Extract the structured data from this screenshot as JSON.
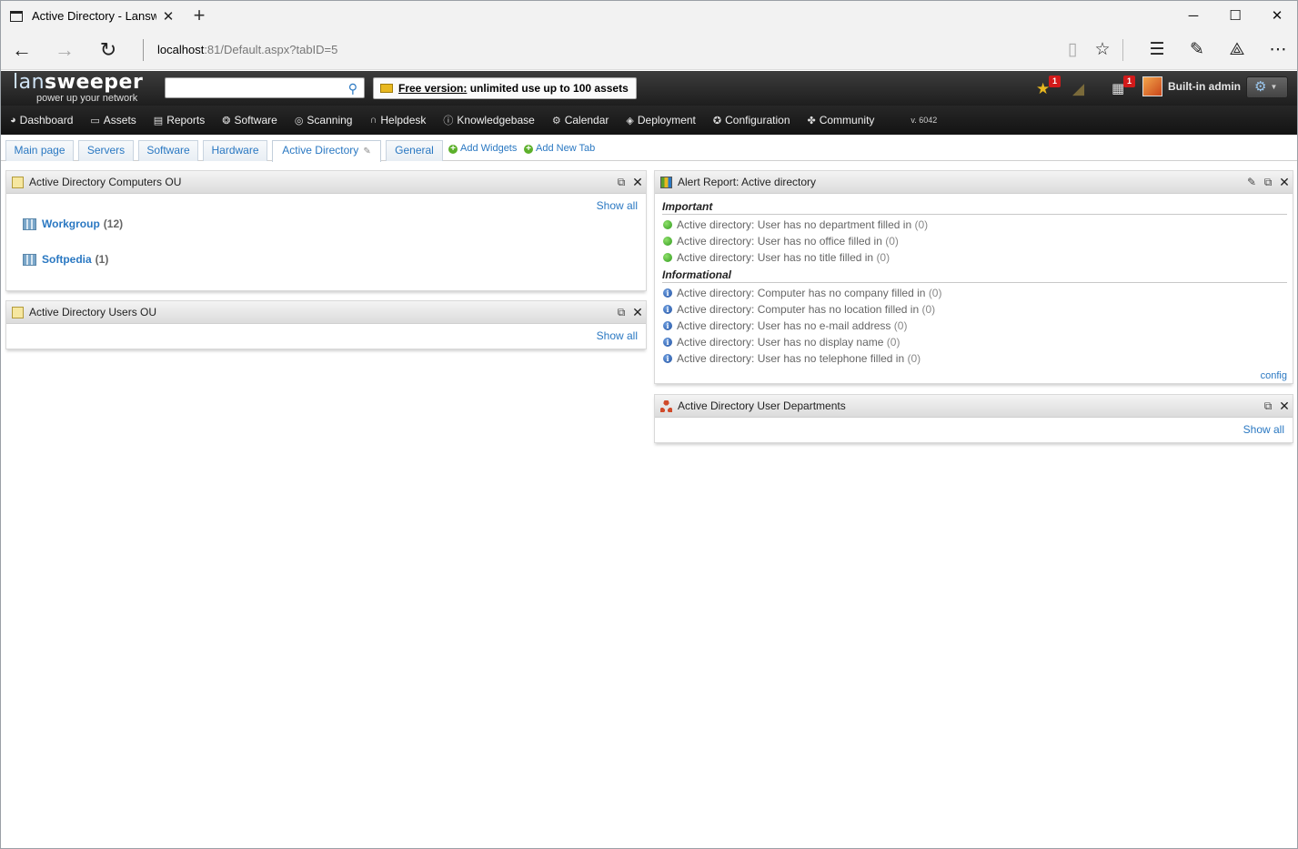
{
  "browser": {
    "tab_title": "Active Directory - Lansw",
    "new_tab": "+",
    "url_host": "localhost",
    "url_rest": ":81/Default.aspx?tabID=5",
    "minimize": "─",
    "maximize": "☐",
    "close": "✕"
  },
  "header": {
    "logo_main_a": "lan",
    "logo_main_b": "sweeper",
    "logo_tagline": "power up your network",
    "search_value": "",
    "free_label": "Free version:",
    "free_text": "unlimited use up to 100 assets",
    "favorites_badge": "1",
    "calendar_badge": "1",
    "user_name": "Built-in admin"
  },
  "menu": {
    "items": [
      "Dashboard",
      "Assets",
      "Reports",
      "Software",
      "Scanning",
      "Helpdesk",
      "Knowledgebase",
      "Calendar",
      "Deployment",
      "Configuration",
      "Community"
    ],
    "version": "v. 6042"
  },
  "tabs": {
    "items": [
      "Main page",
      "Servers",
      "Software",
      "Hardware",
      "Active Directory",
      "General"
    ],
    "add_widgets": "Add Widgets",
    "add_new_tab": "Add New Tab"
  },
  "widgets": {
    "computers_ou": {
      "title": "Active Directory Computers OU",
      "show_all": "Show all",
      "items": [
        {
          "name": "Workgroup",
          "count": "(12)"
        },
        {
          "name": "Softpedia",
          "count": "(1)"
        }
      ]
    },
    "users_ou": {
      "title": "Active Directory Users OU",
      "show_all": "Show all"
    },
    "alert_report": {
      "title": "Alert Report: Active directory",
      "important_label": "Important",
      "important": [
        {
          "text": "Active directory: User has no department filled in",
          "count": "(0)"
        },
        {
          "text": "Active directory: User has no office filled in",
          "count": "(0)"
        },
        {
          "text": "Active directory: User has no title filled in",
          "count": "(0)"
        }
      ],
      "informational_label": "Informational",
      "informational": [
        {
          "text": "Active directory: Computer has no company filled in",
          "count": "(0)"
        },
        {
          "text": "Active directory: Computer has no location filled in",
          "count": "(0)"
        },
        {
          "text": "Active directory: User has no e-mail address",
          "count": "(0)"
        },
        {
          "text": "Active directory: User has no display name",
          "count": "(0)"
        },
        {
          "text": "Active directory: User has no telephone filled in",
          "count": "(0)"
        }
      ],
      "config": "config"
    },
    "user_departments": {
      "title": "Active Directory User Departments",
      "show_all": "Show all"
    }
  }
}
